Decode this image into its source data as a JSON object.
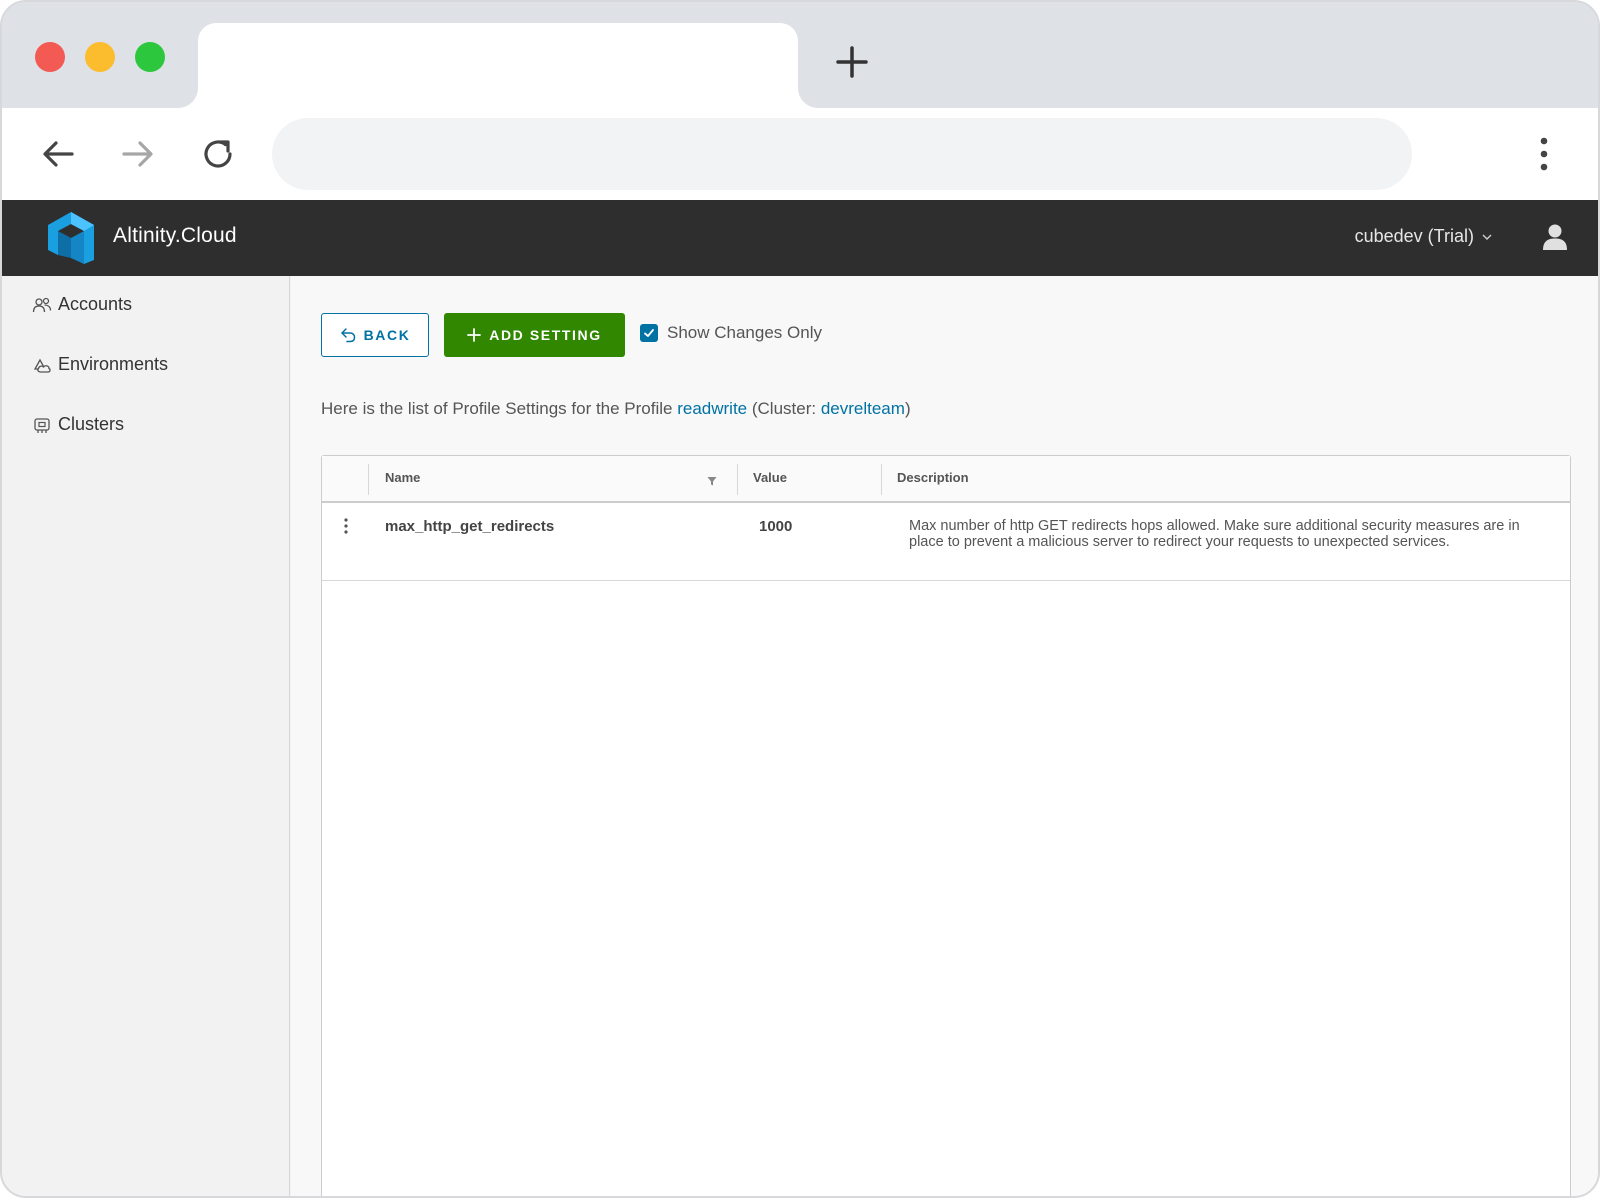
{
  "browser": {
    "new_tab_icon": "plus-icon",
    "back_icon": "arrow-left-icon",
    "forward_icon": "arrow-right-icon",
    "reload_icon": "reload-icon",
    "menu_icon": "vertical-dots-icon"
  },
  "header": {
    "brand": "Altinity.Cloud",
    "account": "cubedev (Trial)",
    "colors": {
      "background": "#2e2e2e",
      "logo_blue": "#1a9fe0"
    }
  },
  "sidebar": {
    "items": [
      {
        "label": "Accounts",
        "icon": "users-icon"
      },
      {
        "label": "Environments",
        "icon": "environments-icon"
      },
      {
        "label": "Clusters",
        "icon": "clusters-icon"
      }
    ]
  },
  "toolbar": {
    "back_label": "BACK",
    "add_label": "ADD SETTING",
    "show_changes_label": "Show Changes Only",
    "show_changes_checked": true,
    "colors": {
      "primary": "#0072a3",
      "success": "#318700"
    }
  },
  "intro": {
    "prefix": "Here is the list of Profile Settings for the Profile ",
    "profile": "readwrite",
    "cluster_prefix": " (Cluster: ",
    "cluster": "devrelteam",
    "suffix": ")"
  },
  "grid": {
    "columns": [
      "Name",
      "Value",
      "Description"
    ],
    "rows": [
      {
        "name": "max_http_get_redirects",
        "value": "1000",
        "description": "Max number of http GET redirects hops allowed. Make sure additional security measures are in place to prevent a malicious server to redirect your requests to unexpected services."
      }
    ]
  }
}
